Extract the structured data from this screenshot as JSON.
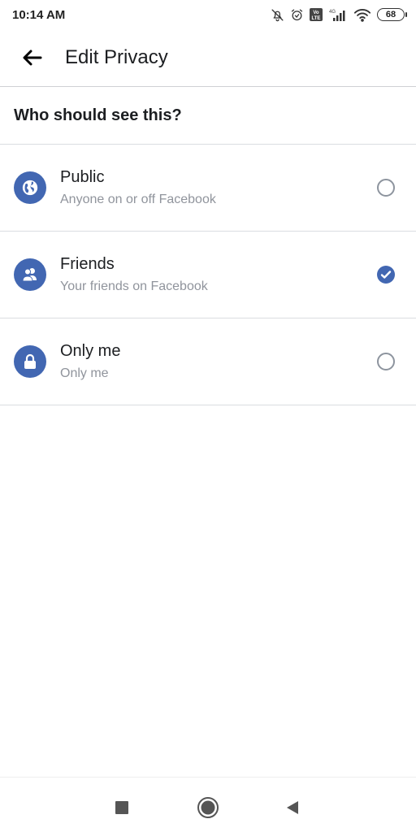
{
  "status_bar": {
    "time": "10:14 AM",
    "icons": [
      "mute-bell-icon",
      "alarm-icon",
      "volte-icon",
      "signal-4g-icon",
      "wifi-icon"
    ],
    "network_label": "4G",
    "volte_label": "Vo LTE",
    "battery": "68"
  },
  "header": {
    "back_icon": "arrow-left-icon",
    "title": "Edit Privacy"
  },
  "section": {
    "heading": "Who should see this?"
  },
  "options": [
    {
      "icon": "globe-icon",
      "title": "Public",
      "subtitle": "Anyone on or off Facebook",
      "selected": false
    },
    {
      "icon": "friends-icon",
      "title": "Friends",
      "subtitle": "Your friends on Facebook",
      "selected": true
    },
    {
      "icon": "lock-icon",
      "title": "Only me",
      "subtitle": "Only me",
      "selected": false
    }
  ],
  "nav_bar": {
    "buttons": [
      "recents",
      "home",
      "back"
    ]
  },
  "colors": {
    "accent": "#4267b2",
    "text_primary": "#1c1e21",
    "text_secondary": "#90949c",
    "divider": "#dadde1"
  }
}
